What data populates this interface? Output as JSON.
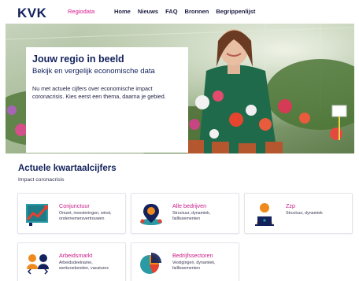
{
  "header": {
    "logo": "KVK",
    "site_tag": "Regiodata",
    "nav": [
      "Home",
      "Nieuws",
      "FAQ",
      "Bronnen",
      "Begrippenlijst"
    ]
  },
  "hero": {
    "title": "Jouw regio in beeld",
    "subtitle": "Bekijk en vergelijk economische data",
    "text": "Nu met actuele cijfers over economische impact coronacrisis. Kies eerst een thema, daarna je gebied."
  },
  "section": {
    "title": "Actuele kwartaalcijfers",
    "subtitle": "Impact coronacrisis"
  },
  "tiles": [
    {
      "title": "Conjunctuur",
      "desc": "Omzet, investeringen, winst, ondernemersvertrouwen",
      "icon": "chart-trend-icon"
    },
    {
      "title": "Alle bedrijven",
      "desc": "Structuur, dynamiek, faillissementen",
      "icon": "map-pin-icon"
    },
    {
      "title": "Zzp",
      "desc": "Structuur, dynamiek",
      "icon": "person-laptop-icon"
    },
    {
      "title": "Arbeidsmarkt",
      "desc": "Arbeidsdeelname, werkzoekenden, vacatures",
      "icon": "workers-icon"
    },
    {
      "title": "Bedrijfssectoren",
      "desc": "Vestigingen, dynamiek, faillissementen",
      "icon": "pie-chart-icon"
    }
  ],
  "colors": {
    "brand_navy": "#13225c",
    "accent_magenta": "#c61a86",
    "icon_orange": "#f08a1c",
    "icon_teal": "#2a9aa5"
  }
}
